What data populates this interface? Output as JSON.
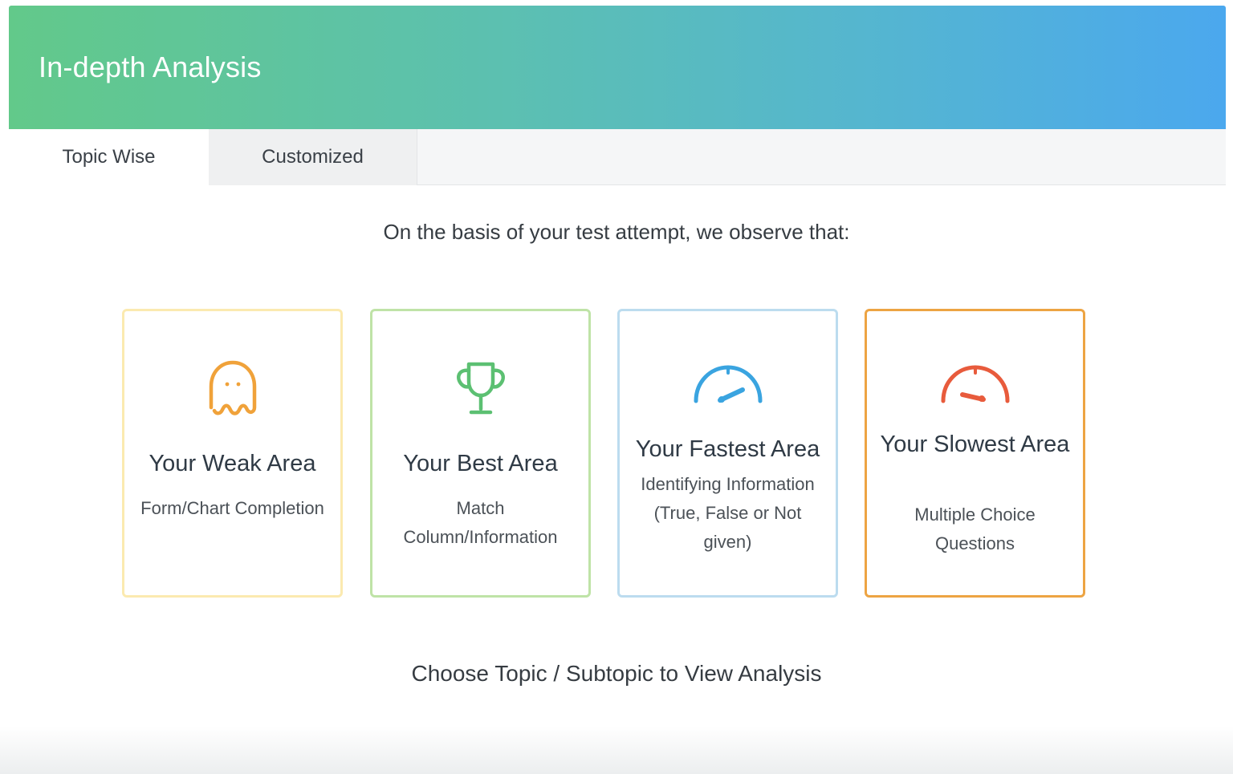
{
  "header": {
    "title": "In-depth Analysis",
    "gradient_start": "#62c98a",
    "gradient_end": "#4ba8ee"
  },
  "tabs": [
    {
      "label": "Topic Wise",
      "active": true
    },
    {
      "label": "Customized",
      "active": false
    }
  ],
  "intro_text": "On the basis of your test attempt, we observe that:",
  "cards": [
    {
      "title": "Your Weak Area",
      "description": "Form/Chart Completion",
      "icon": "ghost-icon",
      "color": "#f0a23a",
      "border": "#fbeab0"
    },
    {
      "title": "Your Best Area",
      "description": "Match Column/Information",
      "icon": "trophy-icon",
      "color": "#5cc072",
      "border": "#bfe3a7"
    },
    {
      "title": "Your Fastest Area",
      "description": "Identifying Information (True, False or Not given)",
      "icon": "speedometer-fast-icon",
      "color": "#3aa4e0",
      "border": "#bcdcef"
    },
    {
      "title": "Your Slowest Area",
      "description": "Multiple Choice Questions",
      "icon": "speedometer-slow-icon",
      "color": "#e85b3c",
      "border": "#eda443"
    }
  ],
  "choose_text": "Choose Topic / Subtopic to View Analysis"
}
